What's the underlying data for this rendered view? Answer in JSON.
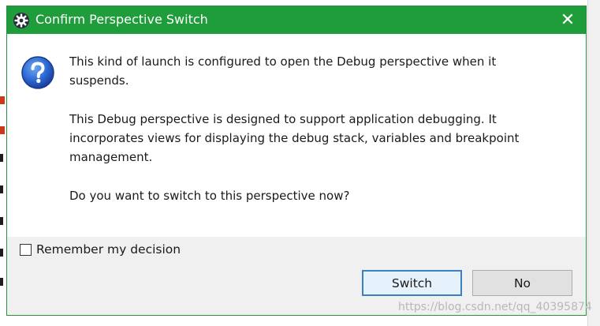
{
  "dialog": {
    "title": "Confirm Perspective Switch",
    "close_glyph": "✕",
    "message": {
      "para1_line1": "This kind of launch is configured to open the Debug perspective when it",
      "para1_line2": "suspends.",
      "para2_line1": "This Debug perspective is designed to support application debugging. It",
      "para2_line2": "incorporates views for displaying the debug stack, variables and breakpoint",
      "para2_line3": "management.",
      "para3": "Do you want to switch to this perspective now?"
    },
    "remember_label": "Remember my decision",
    "remember_checked": false,
    "buttons": {
      "switch": "Switch",
      "no": "No"
    },
    "icons": {
      "title": "gear-icon",
      "message": "question-icon",
      "close": "close-icon"
    }
  },
  "watermark": "https://blog.csdn.net/qq_40395874",
  "colors": {
    "titlebar": "#1f9d3b",
    "default_button_border": "#3c7fc4"
  }
}
